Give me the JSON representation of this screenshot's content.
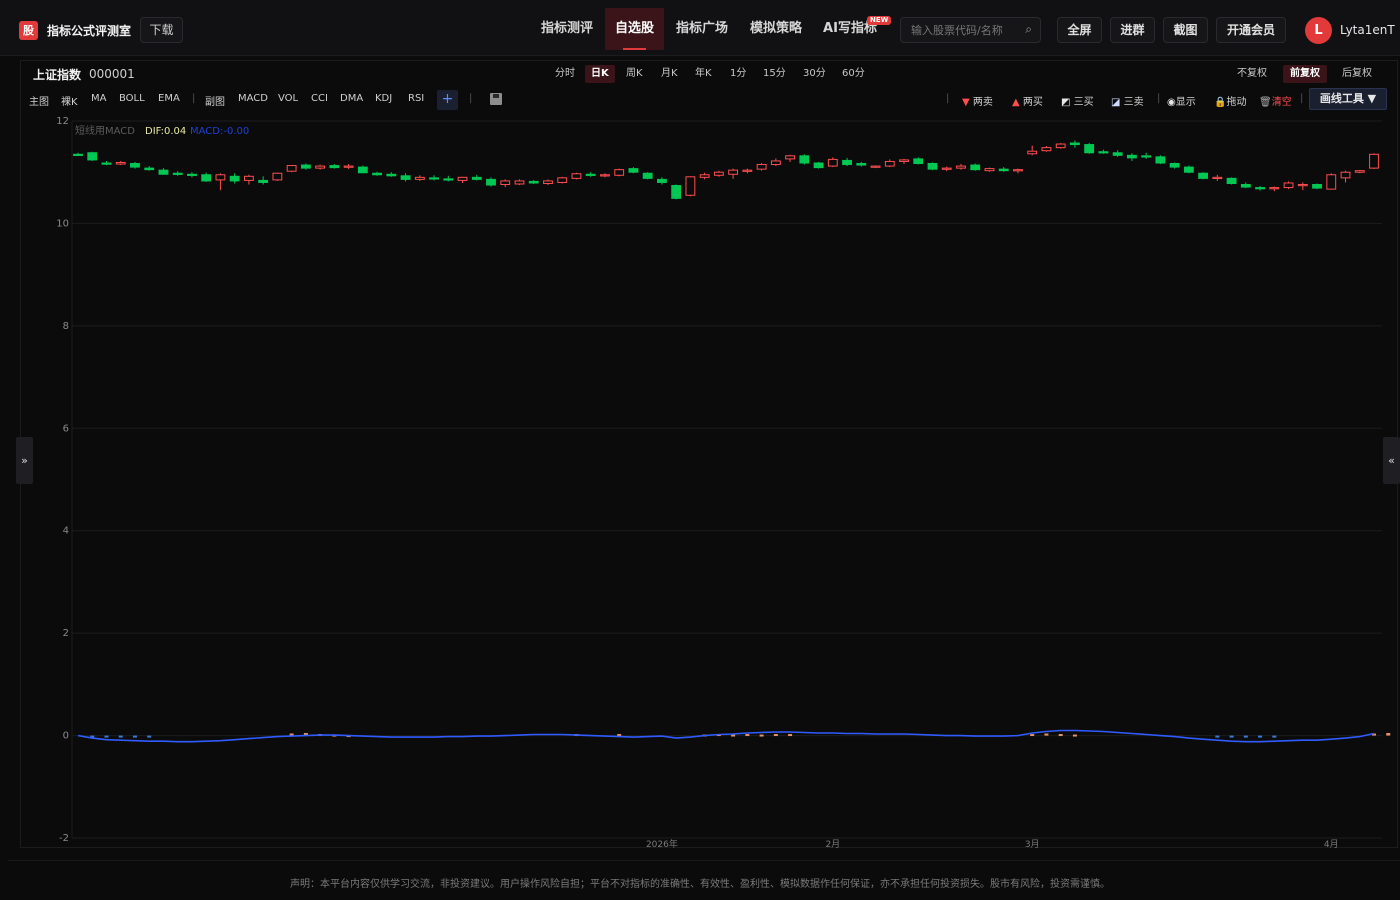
{
  "app": {
    "logo_char": "股",
    "title": "指标公式评测室",
    "download": "下载"
  },
  "nav": [
    {
      "label": "指标测评",
      "active": false
    },
    {
      "label": "自选股",
      "active": true
    },
    {
      "label": "指标广场",
      "active": false
    },
    {
      "label": "模拟策略",
      "active": false
    },
    {
      "label": "AI写指标",
      "active": false
    }
  ],
  "new_badge": "NEW",
  "search": {
    "placeholder": "输入股票代码/名称",
    "icon": "search-icon"
  },
  "top_buttons": [
    "全屏",
    "进群",
    "截图",
    "开通会员"
  ],
  "user": {
    "initial": "L",
    "name": "Lyta1enT"
  },
  "stock": {
    "name": "上证指数",
    "code": "000001"
  },
  "periods": [
    {
      "label": "分时",
      "active": false
    },
    {
      "label": "日K",
      "active": true
    },
    {
      "label": "周K",
      "active": false
    },
    {
      "label": "月K",
      "active": false
    },
    {
      "label": "年K",
      "active": false
    },
    {
      "label": "1分",
      "active": false
    },
    {
      "label": "15分",
      "active": false
    },
    {
      "label": "30分",
      "active": false
    },
    {
      "label": "60分",
      "active": false
    }
  ],
  "adjust": [
    {
      "label": "不复权",
      "active": false
    },
    {
      "label": "前复权",
      "active": true
    },
    {
      "label": "后复权",
      "active": false
    }
  ],
  "indicators_main": [
    "主图",
    "裸K",
    "MA",
    "BOLL",
    "EMA"
  ],
  "indicators_sub": [
    "副图",
    "MACD",
    "VOL",
    "CCI",
    "DMA",
    "KDJ",
    "RSI"
  ],
  "plus": "+",
  "draw_tools": {
    "two_sell": "两卖",
    "two_buy": "两买",
    "three_buy": "三买",
    "three_sell": "三卖",
    "show": "显示",
    "drag": "拖动",
    "clear": "清空",
    "menu": "画线工具 ▼"
  },
  "side_left": "»",
  "side_right": "«",
  "footer": "声明：本平台内容仅供学习交流，非投资建议。用户操作风险自担；平台不对指标的准确性、有效性、盈利性、模拟数据作任何保证，亦不承担任何投资损失。股市有风险，投资需谨慎。",
  "colors": {
    "up": "#ff4d4f",
    "down": "#00c853",
    "macd_line": "#2f5bff",
    "dif_label": "#e8e8a0",
    "macd_label": "#1f3fd8",
    "accent": "#e23a3a"
  },
  "chart_data": {
    "type": "candlestick",
    "legend": {
      "name": "短线用MACD",
      "dif": "DIF:0.04",
      "macd": "MACD:-0.00"
    },
    "ylim": [
      -2,
      12
    ],
    "yticks": [
      "12",
      "10",
      "8",
      "6",
      "4",
      "2",
      "0",
      "-2"
    ],
    "ytick_values": [
      12,
      10,
      8,
      6,
      4,
      2,
      0,
      -2
    ],
    "xticks": [
      "2026年",
      "2月",
      "3月",
      "4月"
    ],
    "xtick_index": [
      41,
      53,
      67,
      88
    ],
    "candles": [
      [
        11.35,
        11.38,
        11.32,
        11.33
      ],
      [
        11.38,
        11.4,
        11.22,
        11.24
      ],
      [
        11.18,
        11.22,
        11.14,
        11.16
      ],
      [
        11.16,
        11.22,
        11.14,
        11.19
      ],
      [
        11.17,
        11.2,
        11.07,
        11.1
      ],
      [
        11.08,
        11.12,
        11.03,
        11.05
      ],
      [
        11.04,
        11.08,
        10.95,
        10.96
      ],
      [
        10.98,
        11.02,
        10.93,
        10.97
      ],
      [
        10.96,
        11.0,
        10.9,
        10.94
      ],
      [
        10.95,
        10.99,
        10.81,
        10.83
      ],
      [
        10.85,
        10.98,
        10.65,
        10.95
      ],
      [
        10.92,
        10.98,
        10.78,
        10.83
      ],
      [
        10.84,
        10.95,
        10.76,
        10.92
      ],
      [
        10.84,
        10.92,
        10.76,
        10.8
      ],
      [
        10.85,
        10.99,
        10.83,
        10.98
      ],
      [
        11.02,
        11.14,
        11.0,
        11.13
      ],
      [
        11.14,
        11.17,
        11.05,
        11.08
      ],
      [
        11.08,
        11.15,
        11.05,
        11.12
      ],
      [
        11.13,
        11.16,
        11.07,
        11.09
      ],
      [
        11.1,
        11.16,
        11.06,
        11.12
      ],
      [
        11.1,
        11.13,
        10.98,
        10.99
      ],
      [
        10.98,
        11.01,
        10.93,
        10.95
      ],
      [
        10.96,
        11.0,
        10.91,
        10.93
      ],
      [
        10.93,
        10.98,
        10.82,
        10.86
      ],
      [
        10.86,
        10.94,
        10.83,
        10.9
      ],
      [
        10.89,
        10.94,
        10.84,
        10.88
      ],
      [
        10.87,
        10.93,
        10.82,
        10.85
      ],
      [
        10.84,
        10.91,
        10.79,
        10.9
      ],
      [
        10.9,
        10.95,
        10.84,
        10.86
      ],
      [
        10.86,
        10.9,
        10.72,
        10.75
      ],
      [
        10.76,
        10.86,
        10.71,
        10.83
      ],
      [
        10.77,
        10.86,
        10.75,
        10.83
      ],
      [
        10.82,
        10.85,
        10.77,
        10.79
      ],
      [
        10.78,
        10.86,
        10.75,
        10.83
      ],
      [
        10.8,
        10.91,
        10.78,
        10.89
      ],
      [
        10.88,
        10.99,
        10.86,
        10.97
      ],
      [
        10.96,
        11.0,
        10.91,
        10.94
      ],
      [
        10.94,
        10.98,
        10.9,
        10.95
      ],
      [
        10.94,
        11.07,
        10.92,
        11.05
      ],
      [
        11.07,
        11.1,
        10.98,
        11.0
      ],
      [
        10.98,
        11.0,
        10.86,
        10.88
      ],
      [
        10.86,
        10.9,
        10.76,
        10.8
      ],
      [
        10.74,
        10.76,
        10.47,
        10.49
      ],
      [
        10.55,
        10.92,
        10.53,
        10.91
      ],
      [
        10.9,
        10.99,
        10.86,
        10.95
      ],
      [
        10.94,
        11.03,
        10.91,
        11.0
      ],
      [
        10.96,
        11.07,
        10.87,
        11.04
      ],
      [
        11.02,
        11.07,
        10.98,
        11.04
      ],
      [
        11.06,
        11.18,
        11.03,
        11.15
      ],
      [
        11.15,
        11.27,
        11.12,
        11.22
      ],
      [
        11.26,
        11.34,
        11.2,
        11.32
      ],
      [
        11.32,
        11.35,
        11.15,
        11.18
      ],
      [
        11.18,
        11.2,
        11.07,
        11.09
      ],
      [
        11.12,
        11.29,
        11.1,
        11.25
      ],
      [
        11.23,
        11.28,
        11.12,
        11.15
      ],
      [
        11.17,
        11.2,
        11.11,
        11.14
      ],
      [
        11.11,
        11.13,
        11.08,
        11.12
      ],
      [
        11.12,
        11.25,
        11.1,
        11.21
      ],
      [
        11.21,
        11.26,
        11.16,
        11.24
      ],
      [
        11.26,
        11.29,
        11.15,
        11.17
      ],
      [
        11.17,
        11.19,
        11.04,
        11.06
      ],
      [
        11.06,
        11.11,
        11.02,
        11.08
      ],
      [
        11.08,
        11.16,
        11.05,
        11.12
      ],
      [
        11.14,
        11.17,
        11.03,
        11.05
      ],
      [
        11.03,
        11.09,
        11.01,
        11.07
      ],
      [
        11.06,
        11.1,
        11.01,
        11.03
      ],
      [
        11.03,
        11.07,
        10.98,
        11.05
      ],
      [
        11.36,
        11.52,
        11.33,
        11.41
      ],
      [
        11.42,
        11.51,
        11.4,
        11.48
      ],
      [
        11.48,
        11.57,
        11.46,
        11.55
      ],
      [
        11.57,
        11.62,
        11.48,
        11.54
      ],
      [
        11.54,
        11.57,
        11.36,
        11.38
      ],
      [
        11.4,
        11.44,
        11.36,
        11.38
      ],
      [
        11.38,
        11.43,
        11.3,
        11.33
      ],
      [
        11.33,
        11.37,
        11.22,
        11.28
      ],
      [
        11.32,
        11.38,
        11.26,
        11.31
      ],
      [
        11.3,
        11.33,
        11.16,
        11.18
      ],
      [
        11.17,
        11.19,
        11.07,
        11.1
      ],
      [
        11.1,
        11.13,
        10.98,
        11.0
      ],
      [
        10.98,
        11.0,
        10.86,
        10.88
      ],
      [
        10.88,
        10.95,
        10.83,
        10.9
      ],
      [
        10.88,
        10.9,
        10.76,
        10.78
      ],
      [
        10.76,
        10.8,
        10.69,
        10.71
      ],
      [
        10.7,
        10.73,
        10.64,
        10.68
      ],
      [
        10.68,
        10.72,
        10.63,
        10.7
      ],
      [
        10.7,
        10.82,
        10.67,
        10.79
      ],
      [
        10.74,
        10.8,
        10.65,
        10.76
      ],
      [
        10.76,
        10.78,
        10.67,
        10.69
      ],
      [
        10.67,
        10.98,
        10.66,
        10.95
      ],
      [
        10.89,
        11.03,
        10.8,
        11.0
      ],
      [
        11.0,
        11.04,
        10.98,
        11.03
      ],
      [
        11.08,
        11.37,
        11.06,
        11.35
      ]
    ],
    "dif": [
      0.0,
      -0.05,
      -0.08,
      -0.09,
      -0.1,
      -0.11,
      -0.11,
      -0.12,
      -0.12,
      -0.11,
      -0.1,
      -0.08,
      -0.06,
      -0.04,
      -0.02,
      -0.01,
      0.0,
      0.01,
      0.01,
      0.0,
      -0.01,
      -0.02,
      -0.03,
      -0.03,
      -0.03,
      -0.03,
      -0.02,
      -0.02,
      -0.01,
      -0.01,
      0.0,
      0.01,
      0.02,
      0.02,
      0.02,
      0.01,
      0.0,
      -0.01,
      -0.02,
      -0.03,
      -0.02,
      -0.01,
      -0.05,
      -0.03,
      0.0,
      0.02,
      0.03,
      0.05,
      0.06,
      0.07,
      0.07,
      0.06,
      0.05,
      0.05,
      0.04,
      0.04,
      0.03,
      0.03,
      0.03,
      0.02,
      0.01,
      0.0,
      0.0,
      -0.01,
      -0.01,
      -0.01,
      0.0,
      0.05,
      0.08,
      0.1,
      0.1,
      0.09,
      0.08,
      0.06,
      0.04,
      0.02,
      0.0,
      -0.02,
      -0.05,
      -0.07,
      -0.09,
      -0.11,
      -0.12,
      -0.12,
      -0.11,
      -0.1,
      -0.09,
      -0.09,
      -0.07,
      -0.05,
      -0.02,
      0.04
    ],
    "macd_hist": [
      0.0,
      -0.01,
      -0.01,
      -0.02,
      -0.01,
      -0.01,
      0.0,
      0.0,
      0.0,
      0.0,
      0.0,
      0.0,
      0.0,
      0.0,
      0.0,
      0.04,
      0.05,
      0.03,
      0.02,
      0.01,
      0.0,
      0.0,
      0.0,
      0.0,
      0.0,
      0.0,
      0.0,
      0.0,
      0.0,
      0.0,
      0.0,
      0.0,
      0.0,
      0.0,
      0.0,
      0.03,
      0.0,
      0.0,
      0.03,
      0.0,
      0.0,
      0.0,
      0.0,
      0.0,
      0.02,
      0.03,
      0.02,
      0.03,
      0.02,
      0.03,
      0.03,
      0.0,
      0.0,
      0.0,
      0.0,
      0.0,
      0.0,
      0.0,
      0.0,
      0.0,
      0.0,
      0.0,
      0.0,
      0.0,
      0.0,
      0.0,
      0.0,
      0.03,
      0.04,
      0.03,
      0.02,
      0.0,
      0.0,
      0.0,
      0.0,
      0.0,
      0.0,
      0.0,
      0.0,
      0.0,
      -0.01,
      -0.02,
      -0.02,
      -0.02,
      -0.02,
      0.0,
      0.0,
      0.0,
      0.0,
      0.0,
      0.0,
      0.04,
      0.05,
      0.04,
      0.03,
      0.06
    ]
  }
}
